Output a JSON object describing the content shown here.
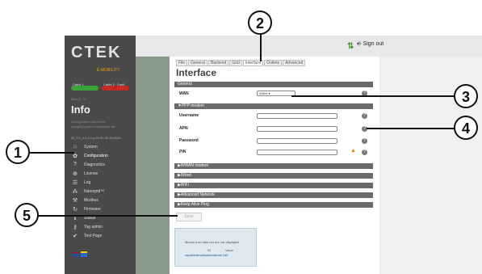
{
  "brand": {
    "logo": "CTEK",
    "sub": "E-MOBILITY"
  },
  "status": {
    "left": "Cable 1",
    "right": "Cable 2 · Fault",
    "small": "Dev. X ∙ Y"
  },
  "info": {
    "title": "Info",
    "blur1": "Configuration allows the",
    "blur2": "charging point is reachable via",
    "id": "ID_TO_0 4 0 0 g 2h 0h 0h 0h 0h0h"
  },
  "nav": [
    {
      "label": "System",
      "icon": "home-icon"
    },
    {
      "label": "Configuration",
      "icon": "gear-icon"
    },
    {
      "label": "Diagnostics",
      "icon": "question-icon"
    },
    {
      "label": "License",
      "icon": "lock-icon"
    },
    {
      "label": "Log",
      "icon": "list-icon"
    },
    {
      "label": "Nanogrid™",
      "icon": "nanogrid-icon"
    },
    {
      "label": "Modbus",
      "icon": "wrench-icon"
    },
    {
      "label": "Firmware",
      "icon": "refresh-icon"
    },
    {
      "label": "Status",
      "icon": "info-icon"
    },
    {
      "label": "Tag admin",
      "icon": "key-icon"
    },
    {
      "label": "Test Page",
      "icon": "check-icon"
    }
  ],
  "topbar": {
    "signout": "Sign out"
  },
  "tabs": [
    "File",
    "General",
    "Backend",
    "Grid",
    "Interface",
    "Outlets",
    "Advanced"
  ],
  "page_title": "Interface",
  "sections": {
    "general": "General",
    "ppp": "▼PPP modem",
    "wwan": "▶WWAN modem",
    "wired": "▶Wired",
    "wifi": "▶WiFi",
    "adv_network": "▶Advanced Network",
    "keep_alive": "▶Keep Alive Ping"
  },
  "fields": {
    "wan_label": "WAN",
    "wan_value": "Wired",
    "username": "Username",
    "apn": "APN",
    "password": "Password",
    "pin": "PIN"
  },
  "save": "Save",
  "note": {
    "line1": "Means that valid but are not displayed",
    "col1": "ID",
    "col2": "Value",
    "link": "reportInterval/autoInterval 240"
  },
  "callouts": [
    "1",
    "2",
    "3",
    "4",
    "5"
  ]
}
